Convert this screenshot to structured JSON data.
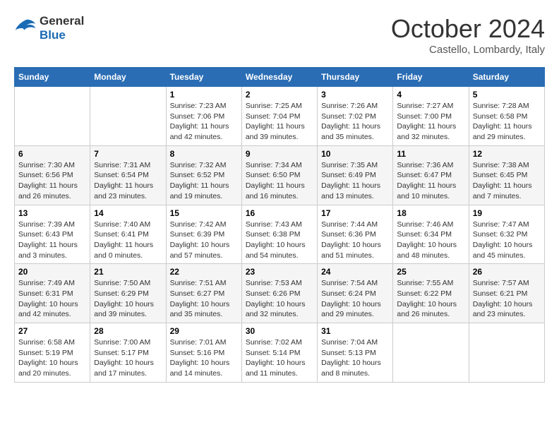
{
  "header": {
    "logo_line1": "General",
    "logo_line2": "Blue",
    "month": "October 2024",
    "location": "Castello, Lombardy, Italy"
  },
  "days_of_week": [
    "Sunday",
    "Monday",
    "Tuesday",
    "Wednesday",
    "Thursday",
    "Friday",
    "Saturday"
  ],
  "weeks": [
    [
      {
        "day": "",
        "info": ""
      },
      {
        "day": "",
        "info": ""
      },
      {
        "day": "1",
        "info": "Sunrise: 7:23 AM\nSunset: 7:06 PM\nDaylight: 11 hours and 42 minutes."
      },
      {
        "day": "2",
        "info": "Sunrise: 7:25 AM\nSunset: 7:04 PM\nDaylight: 11 hours and 39 minutes."
      },
      {
        "day": "3",
        "info": "Sunrise: 7:26 AM\nSunset: 7:02 PM\nDaylight: 11 hours and 35 minutes."
      },
      {
        "day": "4",
        "info": "Sunrise: 7:27 AM\nSunset: 7:00 PM\nDaylight: 11 hours and 32 minutes."
      },
      {
        "day": "5",
        "info": "Sunrise: 7:28 AM\nSunset: 6:58 PM\nDaylight: 11 hours and 29 minutes."
      }
    ],
    [
      {
        "day": "6",
        "info": "Sunrise: 7:30 AM\nSunset: 6:56 PM\nDaylight: 11 hours and 26 minutes."
      },
      {
        "day": "7",
        "info": "Sunrise: 7:31 AM\nSunset: 6:54 PM\nDaylight: 11 hours and 23 minutes."
      },
      {
        "day": "8",
        "info": "Sunrise: 7:32 AM\nSunset: 6:52 PM\nDaylight: 11 hours and 19 minutes."
      },
      {
        "day": "9",
        "info": "Sunrise: 7:34 AM\nSunset: 6:50 PM\nDaylight: 11 hours and 16 minutes."
      },
      {
        "day": "10",
        "info": "Sunrise: 7:35 AM\nSunset: 6:49 PM\nDaylight: 11 hours and 13 minutes."
      },
      {
        "day": "11",
        "info": "Sunrise: 7:36 AM\nSunset: 6:47 PM\nDaylight: 11 hours and 10 minutes."
      },
      {
        "day": "12",
        "info": "Sunrise: 7:38 AM\nSunset: 6:45 PM\nDaylight: 11 hours and 7 minutes."
      }
    ],
    [
      {
        "day": "13",
        "info": "Sunrise: 7:39 AM\nSunset: 6:43 PM\nDaylight: 11 hours and 3 minutes."
      },
      {
        "day": "14",
        "info": "Sunrise: 7:40 AM\nSunset: 6:41 PM\nDaylight: 11 hours and 0 minutes."
      },
      {
        "day": "15",
        "info": "Sunrise: 7:42 AM\nSunset: 6:39 PM\nDaylight: 10 hours and 57 minutes."
      },
      {
        "day": "16",
        "info": "Sunrise: 7:43 AM\nSunset: 6:38 PM\nDaylight: 10 hours and 54 minutes."
      },
      {
        "day": "17",
        "info": "Sunrise: 7:44 AM\nSunset: 6:36 PM\nDaylight: 10 hours and 51 minutes."
      },
      {
        "day": "18",
        "info": "Sunrise: 7:46 AM\nSunset: 6:34 PM\nDaylight: 10 hours and 48 minutes."
      },
      {
        "day": "19",
        "info": "Sunrise: 7:47 AM\nSunset: 6:32 PM\nDaylight: 10 hours and 45 minutes."
      }
    ],
    [
      {
        "day": "20",
        "info": "Sunrise: 7:49 AM\nSunset: 6:31 PM\nDaylight: 10 hours and 42 minutes."
      },
      {
        "day": "21",
        "info": "Sunrise: 7:50 AM\nSunset: 6:29 PM\nDaylight: 10 hours and 39 minutes."
      },
      {
        "day": "22",
        "info": "Sunrise: 7:51 AM\nSunset: 6:27 PM\nDaylight: 10 hours and 35 minutes."
      },
      {
        "day": "23",
        "info": "Sunrise: 7:53 AM\nSunset: 6:26 PM\nDaylight: 10 hours and 32 minutes."
      },
      {
        "day": "24",
        "info": "Sunrise: 7:54 AM\nSunset: 6:24 PM\nDaylight: 10 hours and 29 minutes."
      },
      {
        "day": "25",
        "info": "Sunrise: 7:55 AM\nSunset: 6:22 PM\nDaylight: 10 hours and 26 minutes."
      },
      {
        "day": "26",
        "info": "Sunrise: 7:57 AM\nSunset: 6:21 PM\nDaylight: 10 hours and 23 minutes."
      }
    ],
    [
      {
        "day": "27",
        "info": "Sunrise: 6:58 AM\nSunset: 5:19 PM\nDaylight: 10 hours and 20 minutes."
      },
      {
        "day": "28",
        "info": "Sunrise: 7:00 AM\nSunset: 5:17 PM\nDaylight: 10 hours and 17 minutes."
      },
      {
        "day": "29",
        "info": "Sunrise: 7:01 AM\nSunset: 5:16 PM\nDaylight: 10 hours and 14 minutes."
      },
      {
        "day": "30",
        "info": "Sunrise: 7:02 AM\nSunset: 5:14 PM\nDaylight: 10 hours and 11 minutes."
      },
      {
        "day": "31",
        "info": "Sunrise: 7:04 AM\nSunset: 5:13 PM\nDaylight: 10 hours and 8 minutes."
      },
      {
        "day": "",
        "info": ""
      },
      {
        "day": "",
        "info": ""
      }
    ]
  ]
}
